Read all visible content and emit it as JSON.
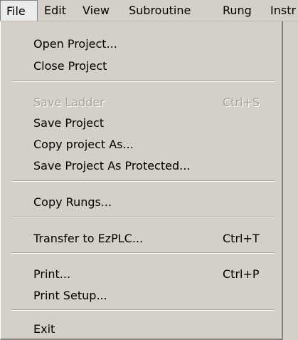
{
  "menubar": {
    "items": [
      "File",
      "Edit",
      "View",
      "Subroutine",
      "Rung",
      "Instr"
    ]
  },
  "file_menu": {
    "items": [
      {
        "label": "Open Project...",
        "shortcut": "",
        "enabled": true
      },
      {
        "label": "Close Project",
        "shortcut": "",
        "enabled": true
      },
      {
        "label": "Save Ladder",
        "shortcut": "Ctrl+S",
        "enabled": false
      },
      {
        "label": "Save Project",
        "shortcut": "",
        "enabled": true
      },
      {
        "label": "Copy project As...",
        "shortcut": "",
        "enabled": true
      },
      {
        "label": "Save Project As Protected...",
        "shortcut": "",
        "enabled": true
      },
      {
        "label": "Copy Rungs...",
        "shortcut": "",
        "enabled": true
      },
      {
        "label": "Transfer to EzPLC...",
        "shortcut": "Ctrl+T",
        "enabled": true
      },
      {
        "label": "Print...",
        "shortcut": "Ctrl+P",
        "enabled": true
      },
      {
        "label": "Print Setup...",
        "shortcut": "",
        "enabled": true
      },
      {
        "label": "Exit",
        "shortcut": "",
        "enabled": true
      }
    ]
  }
}
